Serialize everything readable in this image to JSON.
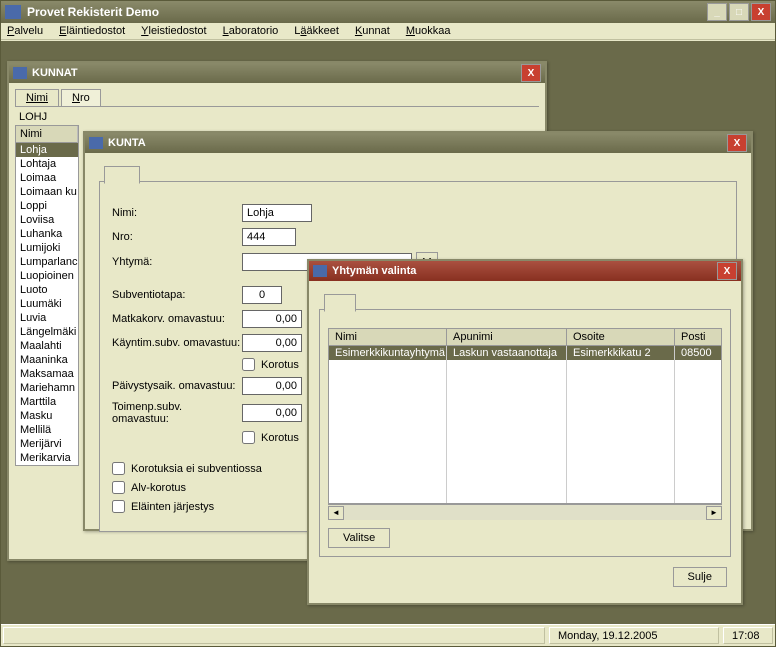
{
  "app": {
    "title": "Provet Rekisterit Demo"
  },
  "menu": {
    "palvelu": "Palvelu",
    "elaintiedostot": "Eläintiedostot",
    "yleistiedostot": "Yleistiedostot",
    "laboratorio": "Laboratorio",
    "laakkeet": "Lääkkeet",
    "kunnat": "Kunnat",
    "muokkaa": "Muokkaa"
  },
  "status": {
    "date": "Monday, 19.12.2005",
    "time": "17:08"
  },
  "kunnat": {
    "title": "KUNNAT",
    "tab_nimi": "Nimi",
    "tab_nro": "Nro",
    "search": "LOHJ",
    "col_nimi": "Nimi",
    "rows": [
      "Lohja",
      "Lohtaja",
      "Loimaa",
      "Loimaan ku",
      "Loppi",
      "Loviisa",
      "Luhanka",
      "Lumijoki",
      "Lumparlanc",
      "Luopioinen",
      "Luoto",
      "Luumäki",
      "Luvia",
      "Längelmäki",
      "Maalahti",
      "Maaninka",
      "Maksamaa",
      "Mariehamn",
      "Marttila",
      "Masku",
      "Mellilä",
      "Merijärvi",
      "Merikarvia"
    ]
  },
  "kunta": {
    "title": "KUNTA",
    "labels": {
      "nimi": "Nimi:",
      "nro": "Nro:",
      "yhtyma": "Yhtymä:",
      "subventiotapa": "Subventiotapa:",
      "matkakorv": "Matkakorv. omavastuu:",
      "kayntim": "Käyntim.subv. omavastuu:",
      "korotus": "Korotus",
      "paivystys": "Päivystysaik. omavastuu:",
      "toimenp": "Toimenp.subv. omavastuu:",
      "chk1": "Korotuksia ei subventiossa",
      "chk2": "Alv-korotus",
      "chk3": "Eläinten järjestys"
    },
    "values": {
      "nimi": "Lohja",
      "nro": "444",
      "yhtyma": "",
      "subventiotapa": "0",
      "matkakorv": "0,00",
      "kayntim": "0,00",
      "paivystys": "0,00",
      "toimenp": "0,00"
    },
    "ybtn": "Y"
  },
  "yht": {
    "title": "Yhtymän valinta",
    "cols": {
      "nimi": "Nimi",
      "apunimi": "Apunimi",
      "osoite": "Osoite",
      "posti": "Posti"
    },
    "row": {
      "nimi": "Esimerkkikuntayhtymä",
      "apunimi": "Laskun vastaanottaja",
      "osoite": "Esimerkkikatu 2",
      "posti": "08500"
    },
    "valitse": "Valitse",
    "sulje": "Sulje"
  }
}
